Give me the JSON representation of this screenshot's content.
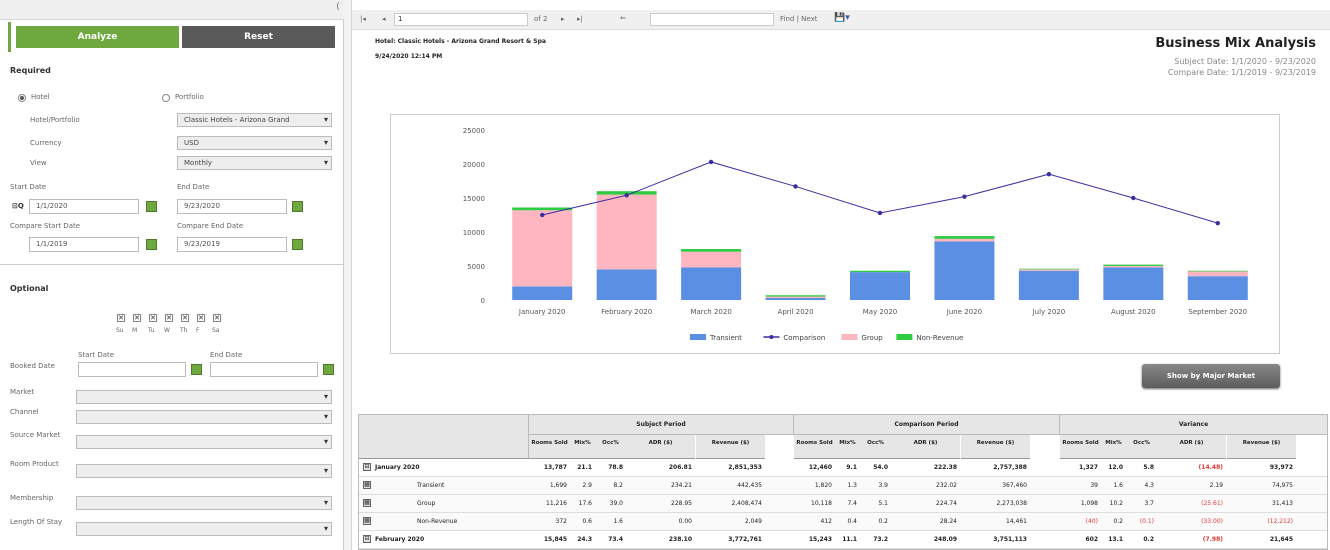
{
  "left": {
    "analyze_label": "Analyze",
    "reset_label": "Reset",
    "required_label": "Required",
    "hotel_label": "Hotel",
    "portfolio_label": "Portfolio",
    "hotel_portfolio_label": "Hotel/Portfolio",
    "hotel_portfolio_value": "Classic Hotels - Arizona Grand",
    "currency_label": "Currency",
    "currency_value": "USD",
    "view_label": "View",
    "view_value": "Monthly",
    "start_date_label": "Start Date",
    "start_date_value": "1/1/2020",
    "end_date_label": "End Date",
    "end_date_value": "9/23/2020",
    "compare_start_label": "Compare Start Date",
    "compare_start_value": "1/1/2019",
    "compare_end_label": "Compare End Date",
    "compare_end_value": "9/23/2019",
    "optional_label": "Optional",
    "days": [
      "Su",
      "M",
      "Tu",
      "W",
      "Th",
      "F",
      "Sa"
    ],
    "booked_dates_label": "Booked Date",
    "booked_start_label": "Start Date",
    "booked_end_label": "End Date",
    "filters": [
      {
        "label": "Market"
      },
      {
        "label": "Channel"
      },
      {
        "label": "Source Market"
      },
      {
        "label": "Room Product"
      },
      {
        "label": "Membership"
      },
      {
        "label": "Length Of Stay"
      }
    ]
  },
  "toolbar": {
    "page_value": "1",
    "of_pages": "of 2",
    "find_label": "Find | Next"
  },
  "report": {
    "hotel_line": "Hotel: Classic Hotels - Arizona Grand Resort & Spa",
    "datetime": "9/24/2020 12:14 PM",
    "title": "Business Mix Analysis",
    "subject_date": "Subject Date: 1/1/2020 - 9/23/2020",
    "compare_date": "Compare Date: 1/1/2019 - 9/23/2019",
    "major_market_btn": "Show by Major Market"
  },
  "chart_data": {
    "type": "bar",
    "categories": [
      "January 2020",
      "February 2020",
      "March 2020",
      "April 2020",
      "May 2020",
      "June 2020",
      "July 2020",
      "August 2020",
      "September 2020"
    ],
    "ylim": [
      0,
      25000
    ],
    "yticks": [
      "25000",
      "20000",
      "15000",
      "10000",
      "5000",
      "0"
    ],
    "series": [
      {
        "name": "Transient",
        "color": "#5b8fe3",
        "values": [
          2000,
          4500,
          4800,
          300,
          4100,
          8600,
          4300,
          4800,
          3500
        ]
      },
      {
        "name": "Group",
        "color": "#ffb6c1",
        "values": [
          11200,
          11000,
          2300,
          200,
          0,
          400,
          200,
          200,
          700
        ]
      },
      {
        "name": "Non-Revenue",
        "color": "#2ecc40",
        "values": [
          400,
          500,
          400,
          200,
          200,
          400,
          100,
          200,
          100
        ]
      },
      {
        "name": "Comparison",
        "color": "#3a2fa0",
        "values": [
          12500,
          15400,
          20300,
          16700,
          12800,
          15200,
          18500,
          15000,
          11300
        ]
      }
    ],
    "legend_position": "bottom"
  },
  "table": {
    "groups": [
      "Subject Period",
      "Comparison Period",
      "Variance"
    ],
    "cols": [
      "Rooms Sold",
      "Mix%",
      "Occ%",
      "ADR ($)",
      "Revenue ($)"
    ],
    "rows": [
      {
        "label": "January 2020",
        "bold": true,
        "vals": [
          "13,787",
          "21.1",
          "78.8",
          "206.81",
          "2,851,353",
          "12,460",
          "9.1",
          "54.0",
          "222.38",
          "2,757,388",
          "1,327",
          "12.0",
          "5.8",
          "(14.48)",
          "93,972"
        ]
      },
      {
        "label": "Transient",
        "bold": false,
        "vals": [
          "1,699",
          "2.9",
          "8.2",
          "234.21",
          "442,435",
          "1,820",
          "1.3",
          "3.9",
          "232.02",
          "367,460",
          "39",
          "1.6",
          "4.3",
          "2.19",
          "74,975"
        ]
      },
      {
        "label": "Group",
        "bold": false,
        "vals": [
          "11,216",
          "17.6",
          "39.0",
          "228.95",
          "2,408,474",
          "10,118",
          "7.4",
          "5.1",
          "224.74",
          "2,273,038",
          "1,098",
          "10.2",
          "3.7",
          "(25.61)",
          "31,413"
        ]
      },
      {
        "label": "Non-Revenue",
        "bold": false,
        "vals": [
          "372",
          "0.6",
          "1.6",
          "0.00",
          "2,049",
          "412",
          "0.4",
          "0.2",
          "28.24",
          "14,461",
          "(40)",
          "0.2",
          "(0.1)",
          "(33.00)",
          "(12,212)"
        ]
      },
      {
        "label": "February 2020",
        "bold": true,
        "vals": [
          "15,845",
          "24.3",
          "73.4",
          "238.10",
          "3,772,761",
          "15,243",
          "11.1",
          "73.2",
          "248.09",
          "3,751,113",
          "602",
          "13.1",
          "0.2",
          "(7.98)",
          "21,645"
        ]
      }
    ]
  }
}
